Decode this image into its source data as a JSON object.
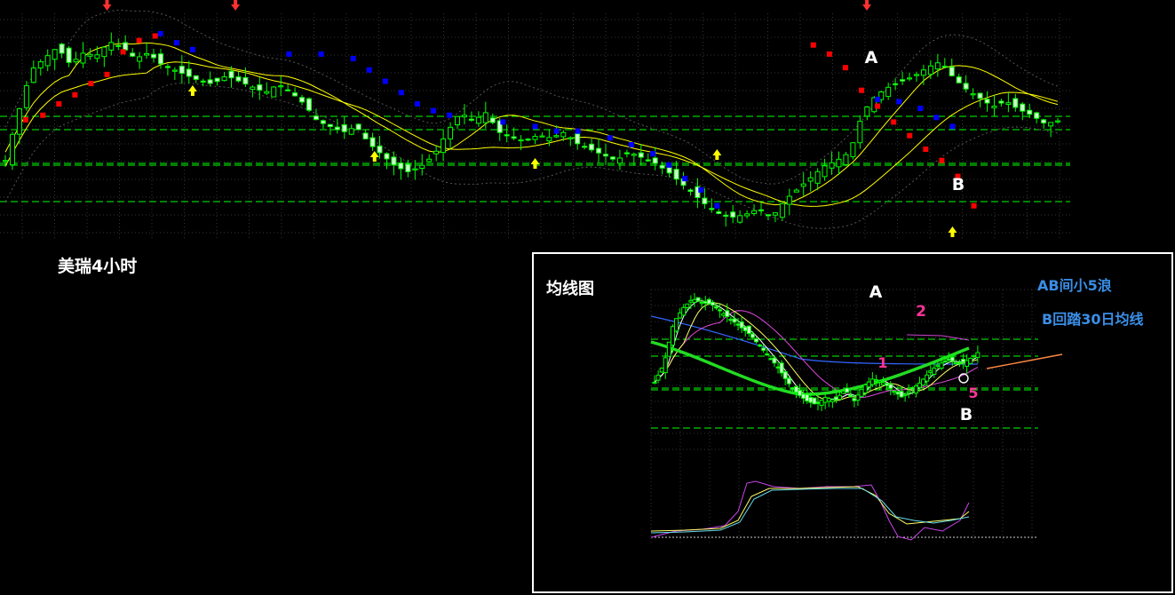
{
  "chart_data": [
    {
      "type": "candlestick",
      "title": "美瑞4小时",
      "annotations": {
        "a": "A",
        "b": "B"
      },
      "colors": {
        "up": "#00ff00",
        "down": "#00ff00",
        "up_fill": "#000000",
        "down_fill": "#ccffcc",
        "sar_up": "#ff0000",
        "sar_down": "#0000ff",
        "ma": "#ffff00",
        "levels": "#00ff00",
        "arrow_down": "#ff3030",
        "arrow_up": "#ffff00"
      },
      "close_path": [
        28,
        45,
        60,
        64,
        68,
        62,
        66,
        65,
        70,
        68,
        64,
        66,
        62,
        60,
        58,
        56,
        55,
        58,
        56,
        54,
        52,
        55,
        52,
        48,
        42,
        40,
        38,
        40,
        34,
        30,
        26,
        24,
        26,
        30,
        38,
        45,
        42,
        45,
        38,
        36,
        35,
        37,
        36,
        38,
        34,
        32,
        30,
        28,
        31,
        29,
        27,
        24,
        20,
        16,
        12,
        9,
        8,
        9,
        11,
        8,
        14,
        18,
        22,
        26,
        28,
        31,
        45,
        51,
        54,
        56,
        58,
        61,
        63,
        57,
        53,
        50,
        47,
        49,
        46,
        44,
        41,
        42
      ],
      "sar": {
        "red": [
          [
            0.024,
            0.47
          ],
          [
            0.04,
            0.45
          ],
          [
            0.055,
            0.4
          ],
          [
            0.07,
            0.36
          ],
          [
            0.085,
            0.31
          ],
          [
            0.1,
            0.27
          ],
          [
            0.115,
            0.17
          ],
          [
            0.13,
            0.12
          ],
          [
            0.145,
            0.1
          ],
          [
            0.76,
            0.14
          ],
          [
            0.775,
            0.18
          ],
          [
            0.79,
            0.24
          ],
          [
            0.805,
            0.34
          ],
          [
            0.82,
            0.41
          ],
          [
            0.835,
            0.48
          ],
          [
            0.85,
            0.54
          ],
          [
            0.865,
            0.6
          ],
          [
            0.88,
            0.65
          ],
          [
            0.895,
            0.72
          ],
          [
            0.91,
            0.85
          ]
        ],
        "blue": [
          [
            0.15,
            0.09
          ],
          [
            0.165,
            0.13
          ],
          [
            0.18,
            0.16
          ],
          [
            0.27,
            0.18
          ],
          [
            0.3,
            0.18
          ],
          [
            0.33,
            0.2
          ],
          [
            0.345,
            0.25
          ],
          [
            0.36,
            0.3
          ],
          [
            0.375,
            0.35
          ],
          [
            0.39,
            0.4
          ],
          [
            0.405,
            0.43
          ],
          [
            0.42,
            0.45
          ],
          [
            0.47,
            0.48
          ],
          [
            0.5,
            0.5
          ],
          [
            0.52,
            0.52
          ],
          [
            0.54,
            0.52
          ],
          [
            0.57,
            0.55
          ],
          [
            0.59,
            0.58
          ],
          [
            0.61,
            0.62
          ],
          [
            0.625,
            0.67
          ],
          [
            0.64,
            0.73
          ],
          [
            0.655,
            0.78
          ],
          [
            0.67,
            0.85
          ],
          [
            0.82,
            0.38
          ],
          [
            0.84,
            0.39
          ],
          [
            0.86,
            0.42
          ],
          [
            0.875,
            0.46
          ],
          [
            0.89,
            0.5
          ]
        ]
      },
      "levels": [
        131,
        146,
        184,
        186,
        227
      ],
      "labels": {
        "a": [
          0.81,
          64
        ],
        "b": [
          0.89,
          207
        ]
      },
      "arrows_down": [
        0.1,
        0.22,
        0.81
      ],
      "arrows_up": [
        0.18,
        0.35,
        0.5,
        0.67,
        0.89
      ]
    },
    {
      "type": "candlestick",
      "title": "均线图",
      "annotations": {
        "a": "A",
        "b": "B",
        "wave1": "1",
        "wave2": "2",
        "wave5": "5",
        "note1": "AB间小5浪",
        "note2": "B回踏30日均线"
      },
      "colors": {
        "candle": "#00ff00",
        "ma_thick": "#22dd22",
        "ma_blue": "#3366ff",
        "ma_magenta": "#cc44cc",
        "ma_yellow": "#ffff66",
        "ma_white": "#ffffff",
        "levels": "#00ff00",
        "wave_labels": "#ff3399",
        "arrow": "#ff8844"
      },
      "close_path": [
        40,
        50,
        72,
        80,
        85,
        83,
        82,
        78,
        74,
        70,
        66,
        60,
        54,
        48,
        40,
        34,
        30,
        28,
        32,
        30,
        36,
        30,
        38,
        42,
        40,
        36,
        32,
        36,
        40,
        46,
        50,
        52,
        50,
        52,
        56
      ]
    }
  ]
}
